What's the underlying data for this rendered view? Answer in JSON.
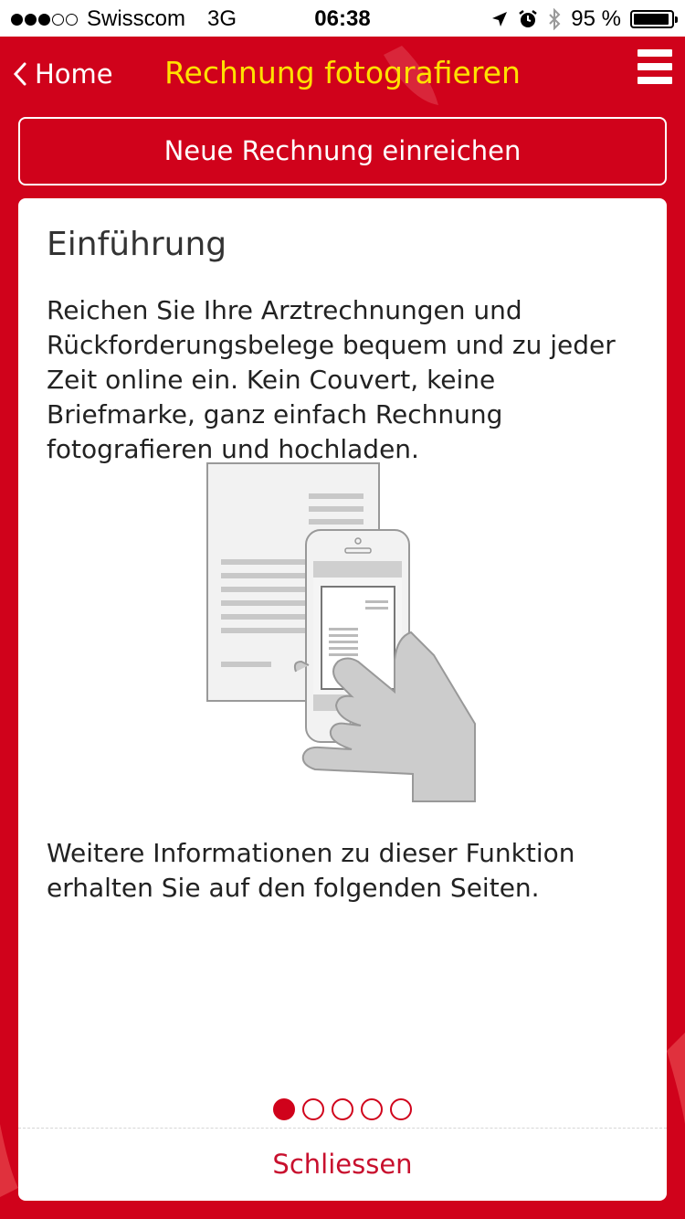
{
  "status_bar": {
    "signal_dots_filled": 3,
    "signal_dots_total": 5,
    "carrier": "Swisscom",
    "network": "3G",
    "time": "06:38",
    "battery_text": "95 %",
    "battery_level": 0.95,
    "icons": [
      "location-arrow-icon",
      "alarm-icon",
      "bluetooth-icon",
      "battery-icon"
    ]
  },
  "nav": {
    "back_label": "Home",
    "title": "Rechnung fotografieren",
    "menu_icon": "hamburger-menu-icon"
  },
  "new_invoice_button": "Neue Rechnung einreichen",
  "card": {
    "title": "Einführung",
    "intro": "Reichen Sie Ihre Arztrechnungen und Rückforderungsbelege bequem und zu jeder Zeit online ein. Kein Couvert, keine Briefmarke, ganz einfach Rechnung fotografieren und hochladen.",
    "more_info": "Weitere Informationen zu dieser Funktion erhalten Sie auf den folgenden Seiten.",
    "illustration_icon": "phone-photographing-invoice-illustration",
    "pager": {
      "total": 5,
      "active_index": 0
    },
    "close_label": "Schliessen"
  },
  "colors": {
    "brand_red": "#d0021b",
    "title_yellow": "#ffe100",
    "close_red": "#c8102e"
  }
}
